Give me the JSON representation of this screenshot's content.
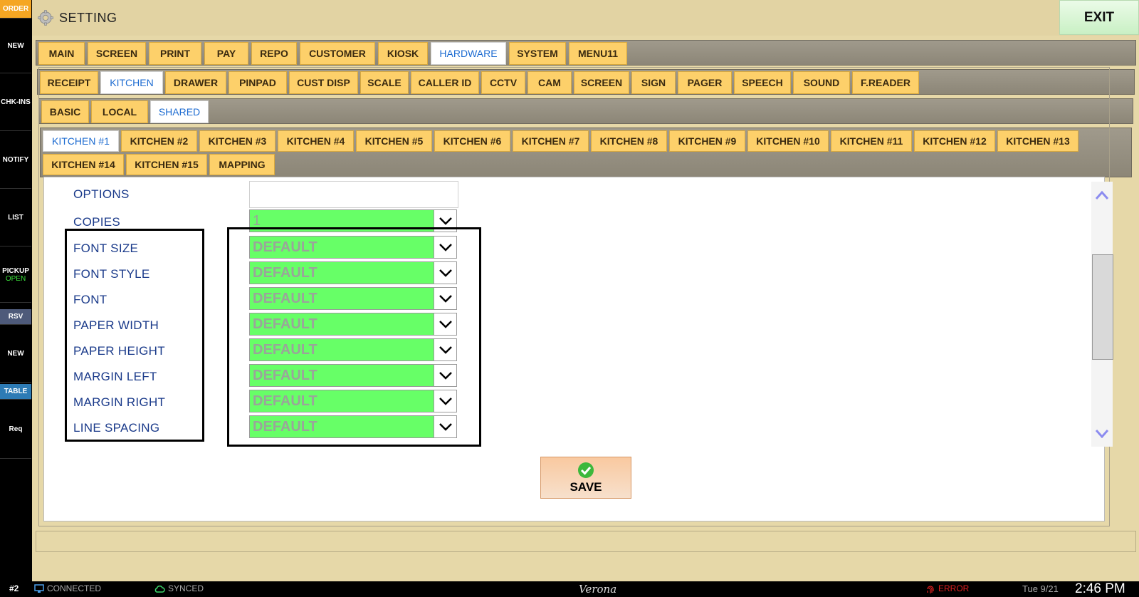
{
  "sidebar": {
    "items": [
      {
        "label": "ORDER"
      },
      {
        "label": "NEW"
      },
      {
        "label": "CHK-INS"
      },
      {
        "label": "NOTIFY"
      },
      {
        "label": "LIST"
      },
      {
        "label": "PICKUP",
        "sub": "OPEN"
      },
      {
        "label": "RSV"
      },
      {
        "label": "NEW"
      },
      {
        "label": "TABLE"
      },
      {
        "label": "Req"
      }
    ]
  },
  "header": {
    "title": "SETTING",
    "exit_label": "EXIT"
  },
  "tabs_main": [
    "MAIN",
    "SCREEN",
    "PRINT",
    "PAY",
    "REPO",
    "CUSTOMER",
    "KIOSK",
    "HARDWARE",
    "SYSTEM",
    "MENU11"
  ],
  "tabs_hardware": [
    "RECEIPT",
    "KITCHEN",
    "DRAWER",
    "PINPAD",
    "CUST DISP",
    "SCALE",
    "CALLER ID",
    "CCTV",
    "CAM",
    "SCREEN",
    "SIGN",
    "PAGER",
    "SPEECH",
    "SOUND",
    "F.READER"
  ],
  "tabs_scope": [
    "BASIC",
    "LOCAL",
    "SHARED"
  ],
  "tabs_kitchen_row1": [
    "KITCHEN #1",
    "KITCHEN #2",
    "KITCHEN #3",
    "KITCHEN #4",
    "KITCHEN #5",
    "KITCHEN #6",
    "KITCHEN #7",
    "KITCHEN #8",
    "KITCHEN #9",
    "KITCHEN #10",
    "KITCHEN #11",
    "KITCHEN #12",
    "KITCHEN #13"
  ],
  "tabs_kitchen_row2": [
    "KITCHEN #14",
    "KITCHEN #15",
    "MAPPING"
  ],
  "form": {
    "options_label": "OPTIONS",
    "copies_label": "COPIES",
    "copies_value": "1",
    "fields": [
      {
        "label": "FONT SIZE",
        "value": "DEFAULT"
      },
      {
        "label": "FONT STYLE",
        "value": "DEFAULT"
      },
      {
        "label": "FONT",
        "value": "DEFAULT"
      },
      {
        "label": "PAPER WIDTH",
        "value": "DEFAULT"
      },
      {
        "label": "PAPER HEIGHT",
        "value": "DEFAULT"
      },
      {
        "label": "MARGIN LEFT",
        "value": "DEFAULT"
      },
      {
        "label": "MARGIN RIGHT",
        "value": "DEFAULT"
      },
      {
        "label": "LINE SPACING",
        "value": "DEFAULT"
      }
    ],
    "save_label": "SAVE"
  },
  "status": {
    "station": "#2",
    "connected": "CONNECTED",
    "synced": "SYNCED",
    "store": "Verona",
    "error": "ERROR",
    "date": "Tue 9/21",
    "time": "2:46 PM"
  },
  "colors": {
    "accent_tab": "#fdd06a",
    "active_tab_text": "#1c6bd1",
    "select_bg": "#67ff67",
    "label_text": "#1a3a8a"
  }
}
